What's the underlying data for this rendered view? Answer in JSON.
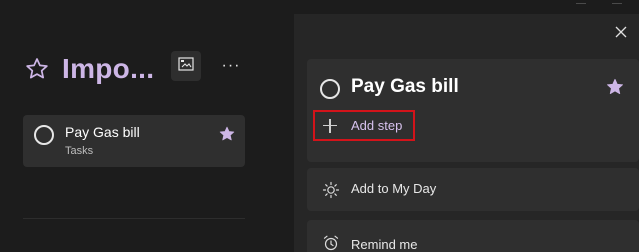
{
  "list": {
    "title": "Impo...",
    "view_button_icon": "picture-view-icon",
    "more_label": "···",
    "task": {
      "title": "Pay Gas bill",
      "subtitle": "Tasks",
      "starred": true
    }
  },
  "detail": {
    "close_icon": "close-icon",
    "task_title": "Pay Gas bill",
    "add_step_label": "Add step",
    "rows": [
      {
        "label": "Add to My Day",
        "icon": "sun-icon"
      },
      {
        "label": "Remind me",
        "icon": "alarm-icon"
      }
    ]
  },
  "colors": {
    "accent": "#cdb6e6",
    "highlight_box": "#d3131a",
    "background": "#1c1c1c",
    "detail_background": "#262626",
    "card": "#2f2f2f"
  }
}
